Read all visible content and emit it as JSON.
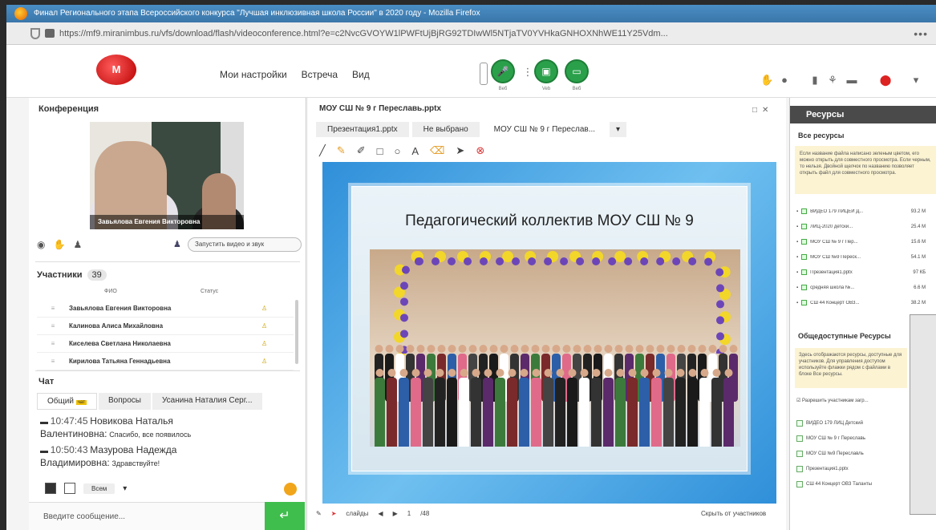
{
  "window": {
    "title": "Финал Регионального этапа Всероссийского конкурса \"Лучшая инклюзивная школа России\" в 2020 году - Mozilla Firefox",
    "url": "https://mf9.miranimbus.ru/vfs/download/flash/videoconference.html?e=c2NvcGVOYW1lPWFtUjBjRG92TDIwWl5NTjaTV0YVHkaGNHOXNhWE11Y25Vdm..."
  },
  "header": {
    "logo": "M",
    "menu": [
      "Мои настройки",
      "Встреча",
      "Вид"
    ],
    "media_captions": [
      "Веб",
      "Veb",
      "Веб"
    ]
  },
  "conference": {
    "title": "Конференция",
    "caption": "Завьялова Евгения Викторовна",
    "media_dropdown": "Запустить видео и звук"
  },
  "participants": {
    "title": "Участники",
    "count": "39",
    "col_name": "ФИО",
    "col_status": "Статус",
    "rows": [
      {
        "name": "Завьялова Евгения Викторовна"
      },
      {
        "name": "Калинова Алиса Михайловна"
      },
      {
        "name": "Киселева Светлана Николаевна"
      },
      {
        "name": "Кирилова Татьяна Геннадьевна"
      }
    ]
  },
  "chat": {
    "title": "Чат",
    "tabs": [
      {
        "label": "Общий",
        "badge": "чат"
      },
      {
        "label": "Вопросы"
      },
      {
        "label": "Усанина Наталия Серг..."
      }
    ],
    "messages": [
      {
        "time": "10:47:45",
        "who": "Новикова Наталья",
        "who2": "Валентиновна:",
        "text": "Спасибо, все появилось"
      },
      {
        "time": "10:50:43",
        "who": "Мазурова Надежда",
        "who2": "Владимировна:",
        "text": "Здравствуйте!"
      }
    ],
    "recipient": "Всем",
    "input_placeholder": "Введите сообщение..."
  },
  "document": {
    "title": "МОУ СШ № 9 г Переславь.pptx",
    "tabs": [
      "Презентация1.pptx",
      "Не выбрано",
      "МОУ СШ № 9 г Переслав...",
      "▾"
    ],
    "slide_title": "Педагогический коллектив МОУ СШ № 9",
    "footer_slides": "слайды",
    "footer_page": "1",
    "footer_total": "/48",
    "footer_hide": "Скрыть от участников"
  },
  "resources": {
    "title": "Ресурсы",
    "all_title": "Все ресурсы",
    "note": "Если название файла написано зеленым цветом, его можно открыть для совместного просмотра. Если черным, то нельзя. Двойной щелчок по названию позволяет открыть файл для совместного просмотра.",
    "items": [
      {
        "name": "ВИДЕО 179 ЛИЦЕЙ Д...",
        "size": "93.2 М"
      },
      {
        "name": "ЛИЦ-2020 детски...",
        "size": "25.4 М"
      },
      {
        "name": "МОУ СШ № 9 г Пер...",
        "size": "15.6 М"
      },
      {
        "name": "МОУ СШ №9 Переск...",
        "size": "54.1 М"
      },
      {
        "name": "Презентация1.pptx",
        "size": "97 КБ"
      },
      {
        "name": "средняя школа №...",
        "size": "6.6 М"
      },
      {
        "name": "СШ 44 Концерт ОВЗ...",
        "size": "38.2 М"
      }
    ],
    "public_title": "Общедоступные Ресурсы",
    "public_note": "Здесь отображаются ресурсы, доступные для участников. Для управления доступом используйте флажки рядом с файлами в блоке Все ресурсы.",
    "allow_label": "Разрешить участникам загр...",
    "public_items": [
      "ВИДЕО 179 ЛИЦ Детский",
      "МОУ СШ № 9 г Переславь",
      "МОУ СШ №9 Переславль",
      "Презентация1.pptx",
      "СШ 44 Концерт ОВЗ Таланты"
    ]
  }
}
